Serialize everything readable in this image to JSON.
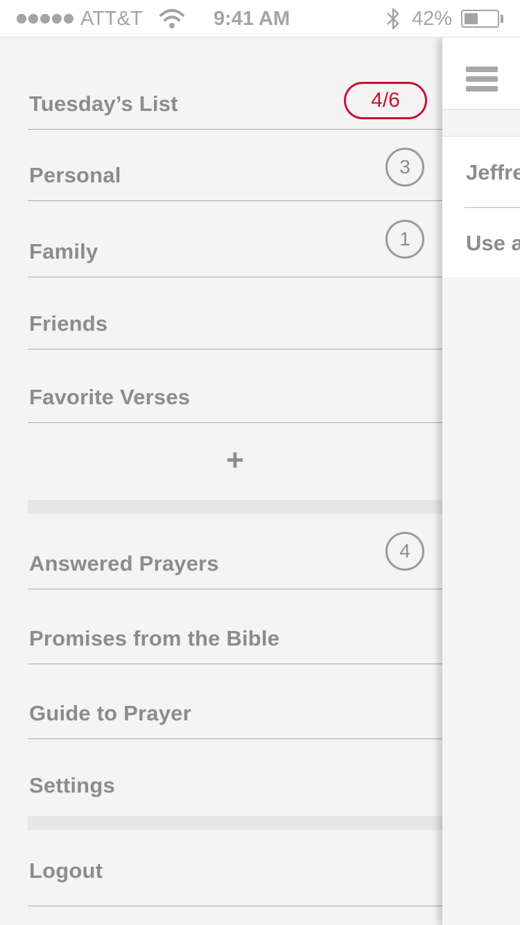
{
  "status_bar": {
    "carrier": "ATT&T",
    "time": "9:41 AM",
    "battery_percent": "42%",
    "battery_level": 0.42,
    "signal_dots": 5
  },
  "menu": {
    "lists": [
      {
        "label": "Tuesday’s List",
        "badge": "4/6",
        "badge_style": "pill"
      },
      {
        "label": "Personal",
        "badge": "3",
        "badge_style": "circle"
      },
      {
        "label": "Family",
        "badge": "1",
        "badge_style": "circle"
      },
      {
        "label": "Friends"
      },
      {
        "label": "Favorite Verses"
      }
    ],
    "add_label": "+",
    "secondary": [
      {
        "label": "Answered Prayers",
        "badge": "4",
        "badge_style": "circle"
      },
      {
        "label": "Promises from the Bible"
      },
      {
        "label": "Guide to Prayer"
      },
      {
        "label": "Settings"
      }
    ],
    "logout_label": "Logout"
  },
  "panel": {
    "items": [
      "Jeffrey",
      "Use a"
    ]
  },
  "colors": {
    "accent": "#c8102e",
    "text": "#8c8c8c",
    "background": "#f3f4f3"
  }
}
